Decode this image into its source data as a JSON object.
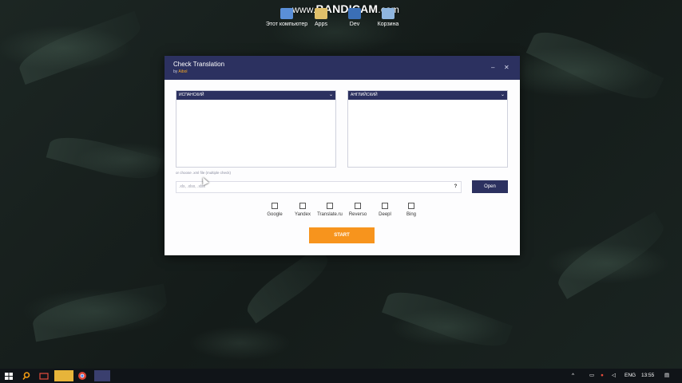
{
  "watermark": {
    "prefix": "www.",
    "brand": "BANDICAM",
    "suffix": ".com"
  },
  "desktop_icons": [
    {
      "label": "Этот компьютер",
      "color": "#5a8fd8"
    },
    {
      "label": "Apps",
      "color": "#e0c06a"
    },
    {
      "label": "Dev",
      "color": "#3b6fb6"
    },
    {
      "label": "Корзина",
      "color": "#8fb6e0"
    }
  ],
  "window": {
    "title": "Check Translation",
    "by_prefix": "by",
    "author": "Aibol",
    "minimize": "–",
    "close": "✕"
  },
  "source_lang": {
    "value": "ИСПАНСКИЙ",
    "text": ""
  },
  "target_lang": {
    "value": "АНГЛИЙСКИЙ",
    "text": ""
  },
  "file": {
    "hint": "or choose .xml file (multiple check)",
    "placeholder": ".xls, .xlsx, .xlsx",
    "help": "?",
    "open_label": "Open"
  },
  "providers": [
    "Google",
    "Yandex",
    "Translate.ru",
    "Reverso",
    "Deepl",
    "Bing"
  ],
  "start_label": "START",
  "taskbar": {
    "language": "ENG",
    "time": "13:55"
  },
  "colors": {
    "accent": "#2c3160",
    "start": "#f7941d"
  }
}
